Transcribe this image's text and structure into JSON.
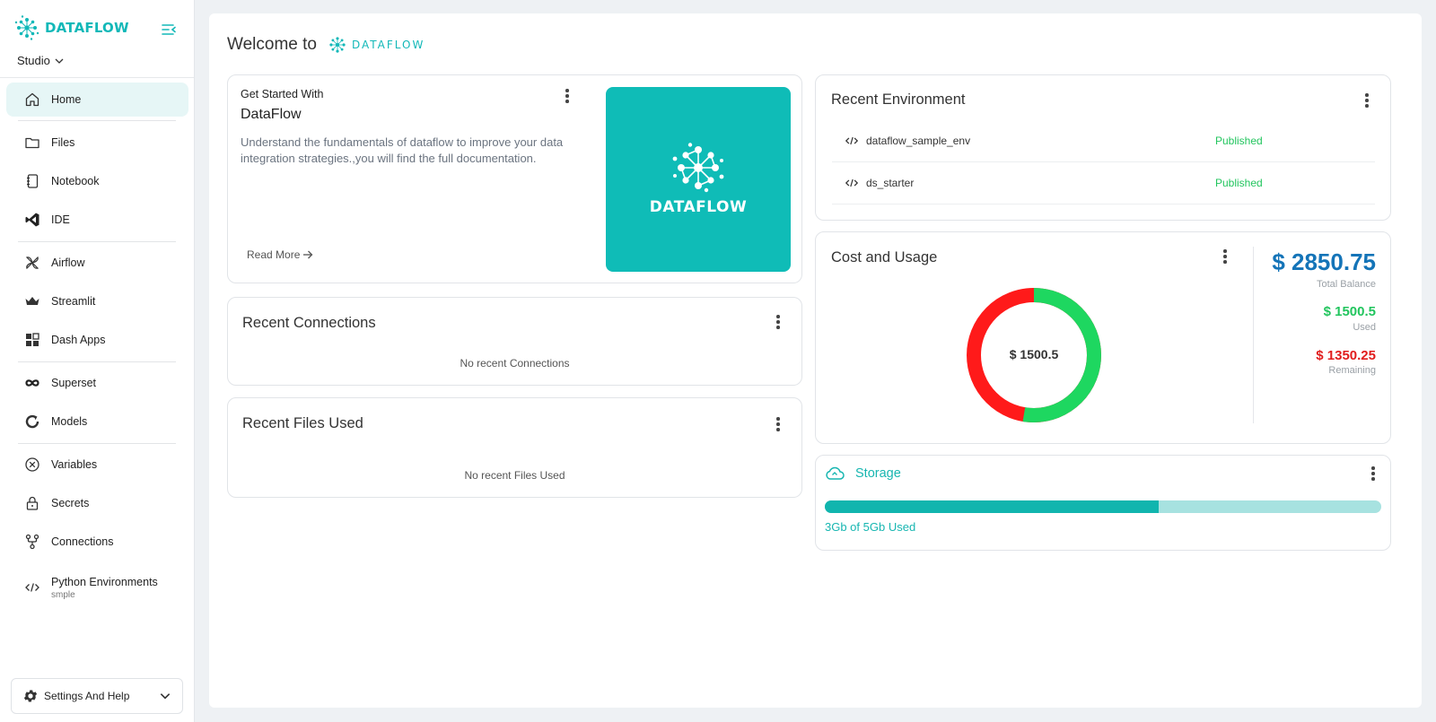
{
  "sidebar": {
    "brand": "DATAFLOW",
    "workspace": "Studio",
    "items": [
      {
        "label": "Home",
        "icon": "home-icon"
      },
      {
        "label": "Files",
        "icon": "folder-icon"
      },
      {
        "label": "Notebook",
        "icon": "notebook-icon"
      },
      {
        "label": "IDE",
        "icon": "vscode-icon"
      },
      {
        "label": "Airflow",
        "icon": "airflow-icon"
      },
      {
        "label": "Streamlit",
        "icon": "crown-icon"
      },
      {
        "label": "Dash Apps",
        "icon": "grid-icon"
      },
      {
        "label": "Superset",
        "icon": "infinity-icon"
      },
      {
        "label": "Models",
        "icon": "refresh-icon"
      },
      {
        "label": "Variables",
        "icon": "x-circle-icon"
      },
      {
        "label": "Secrets",
        "icon": "lock-icon"
      },
      {
        "label": "Connections",
        "icon": "branch-icon"
      },
      {
        "label": "Python Environments",
        "sub": "smple",
        "icon": "code-icon"
      }
    ],
    "settings_label": "Settings And Help"
  },
  "header": {
    "welcome": "Welcome to",
    "brand": "DATAFLOW"
  },
  "get_started": {
    "small": "Get Started With",
    "title": "DataFlow",
    "description": "Understand the fundamentals of dataflow to improve your data integration strategies.,you will find the full documentation.",
    "read_more": "Read More",
    "image_text": "DATAFLOW"
  },
  "recent_connections": {
    "title": "Recent Connections",
    "empty": "No recent Connections"
  },
  "recent_files": {
    "title": "Recent Files Used",
    "empty": "No recent Files Used"
  },
  "recent_environment": {
    "title": "Recent Environment",
    "rows": [
      {
        "name": "dataflow_sample_env",
        "status": "Published"
      },
      {
        "name": "ds_starter",
        "status": "Published"
      }
    ]
  },
  "cost": {
    "title": "Cost and Usage",
    "center": "$ 1500.5",
    "total": "$ 2850.75",
    "total_label": "Total Balance",
    "used": "$ 1500.5",
    "used_label": "Used",
    "remaining": "$ 1350.25",
    "remaining_label": "Remaining",
    "used_value": 1500.5,
    "remaining_value": 1350.25,
    "used_color": "#1ed760",
    "remaining_color": "#ff1a1a"
  },
  "storage": {
    "title": "Storage",
    "used_text": "3Gb of 5Gb Used",
    "used_fraction": 0.6
  }
}
